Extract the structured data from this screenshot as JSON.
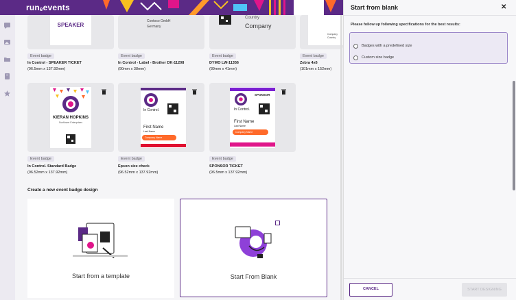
{
  "app": {
    "logo": "runₑevents"
  },
  "templates": [
    {
      "tag": "Event badge",
      "name": "In Control - SPEAKER TICKET",
      "size": "(96.5mm x 137.92mm)",
      "preview_text": "SPEAKER"
    },
    {
      "tag": "Event badge",
      "name": "In Control - Label - Brother DK-11208",
      "size": "(90mm x 38mm)",
      "preview_lines": [
        "Contoso GmbH",
        "Germany"
      ]
    },
    {
      "tag": "Event badge",
      "name": "DYMO LW-11356",
      "size": "(89mm x 41mm)",
      "preview_lines": [
        "Country",
        "Company"
      ]
    },
    {
      "tag": "Event badge",
      "name": "Zebra 4x6",
      "size": "(101mm x 152mm)",
      "preview_lines": [
        "Company",
        "Country"
      ]
    },
    {
      "tag": "Event badge",
      "name": "In Control. Standard Badge",
      "size": "(96.52mm x 137.92mm)",
      "preview_lines": [
        "KIERAN HOPKINS",
        "Sunflower Enterprises"
      ]
    },
    {
      "tag": "Event badge",
      "name": "Epson size check",
      "size": "(96.52mm x 137.92mm)",
      "preview_lines": [
        "In Control.",
        "First Name",
        "Last Name",
        "Company Name"
      ]
    },
    {
      "tag": "Event badge",
      "name": "SPONSOR TICKET",
      "size": "(96.5mm x 137.92mm)",
      "preview_lines": [
        "SPONSOR",
        "In Control.",
        "First Name",
        "Last Name",
        "Company Name"
      ]
    }
  ],
  "create_section": {
    "title": "Create a new event badge design",
    "from_template": "Start from a template",
    "from_blank": "Start From Blank"
  },
  "panel": {
    "title": "Start from blank",
    "instruction": "Please follow up following specifications for the best results:",
    "options": [
      "Badges with a predefined size",
      "Custom size badge"
    ],
    "cancel": "CANCEL",
    "start": "START DESIGNING"
  },
  "colors": {
    "brand": "#5b2a86",
    "accent_pink": "#e0158a",
    "accent_orange": "#ff6a2a",
    "accent_yellow": "#f8c020"
  },
  "icons": [
    "chat-icon",
    "image-icon",
    "folder-icon",
    "badge-icon",
    "star-icon",
    "trash-icon",
    "close-icon"
  ]
}
